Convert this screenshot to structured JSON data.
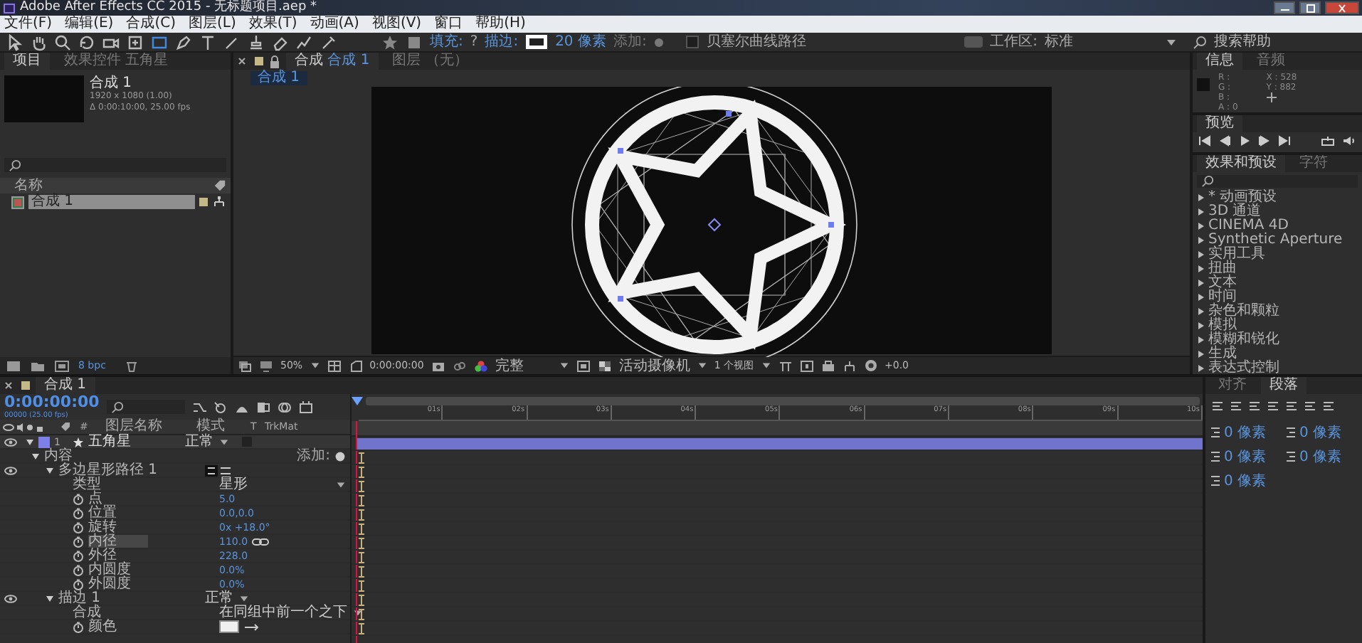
{
  "window": {
    "title": "Adobe After Effects CC 2015 - 无标题项目.aep *"
  },
  "menu": [
    "文件(F)",
    "编辑(E)",
    "合成(C)",
    "图层(L)",
    "效果(T)",
    "动画(A)",
    "视图(V)",
    "窗口",
    "帮助(H)"
  ],
  "tools": [
    {
      "kind": "select",
      "selected": false
    },
    {
      "kind": "hand",
      "selected": false
    },
    {
      "kind": "zoom",
      "selected": false
    },
    {
      "kind": "rotate",
      "selected": false
    },
    {
      "kind": "camera",
      "selected": false
    },
    {
      "kind": "pan",
      "selected": false
    },
    {
      "kind": "rect",
      "selected": true
    },
    {
      "kind": "pen",
      "selected": false
    },
    {
      "kind": "text",
      "selected": false
    },
    {
      "kind": "brush",
      "selected": false
    },
    {
      "kind": "stamp",
      "selected": false
    },
    {
      "kind": "eraser",
      "selected": false
    },
    {
      "kind": "roto",
      "selected": false
    },
    {
      "kind": "pin",
      "selected": false
    }
  ],
  "shape_options": {
    "fill_label": "填充:",
    "fill_value": "?",
    "stroke_label": "描边:",
    "stroke_width": "20 像素",
    "add_label": "添加:",
    "bezier": {
      "label": "贝塞尔曲线路径",
      "checked": false
    }
  },
  "workspace": {
    "label": "工作区:",
    "value": "标准"
  },
  "help_search": {
    "placeholder": "搜索帮助"
  },
  "project": {
    "tabs": [
      {
        "label": "项目",
        "selected": true
      },
      {
        "label": "效果控件 五角星",
        "selected": false
      }
    ],
    "comp_name": "合成 1",
    "comp_size": "1920 x 1080 (1.00)",
    "comp_duration": "Δ 0:00:10:00, 25.00 fps",
    "name_column": "名称",
    "items": [
      {
        "name": "合成 1",
        "selected": true,
        "color": "#c4b788"
      }
    ],
    "bpc": "8 bpc"
  },
  "viewer": {
    "tabs": [
      {
        "prefix": "合成",
        "label": "合成 1",
        "selected": true
      },
      {
        "prefix": "图层",
        "label": "（无）",
        "selected": false
      }
    ],
    "breadcrumb": "合成 1",
    "zoom": "50%",
    "timecode": "0:00:00:00",
    "resolution": "完整",
    "camera": "活动摄像机",
    "views": "1 个视图",
    "exposure": "+0.0"
  },
  "info": {
    "tabs": [
      {
        "label": "信息",
        "selected": true
      },
      {
        "label": "音频",
        "selected": false
      }
    ],
    "channels": [
      "R :",
      "G :",
      "B :",
      "A : 0"
    ],
    "coords": [
      "X : 528",
      "Y : 882"
    ]
  },
  "preview": {
    "title": "预览"
  },
  "effects": {
    "tabs": [
      {
        "label": "效果和预设",
        "selected": true
      },
      {
        "label": "字符",
        "selected": false
      }
    ],
    "items": [
      {
        "label": "* 动画预设",
        "expanded": false
      },
      {
        "label": "3D 通道",
        "expanded": false
      },
      {
        "label": "CINEMA 4D",
        "expanded": false
      },
      {
        "label": "Synthetic Aperture",
        "expanded": false
      },
      {
        "label": "实用工具",
        "expanded": false
      },
      {
        "label": "扭曲",
        "expanded": false
      },
      {
        "label": "文本",
        "expanded": false
      },
      {
        "label": "时间",
        "expanded": false
      },
      {
        "label": "杂色和颗粒",
        "expanded": false
      },
      {
        "label": "模拟",
        "expanded": false
      },
      {
        "label": "模糊和锐化",
        "expanded": false
      },
      {
        "label": "生成",
        "expanded": false
      },
      {
        "label": "表达式控制",
        "expanded": false
      }
    ]
  },
  "timeline": {
    "tab": "合成 1",
    "timecode": "0:00:00:00",
    "frame": "00000 (25.00 fps)",
    "columns": {
      "number": "#",
      "name": "图层名称",
      "mode": "模式",
      "t": "T",
      "trkmat": "TrkMat"
    },
    "ruler": [
      "01s",
      "02s",
      "03s",
      "04s",
      "05s",
      "06s",
      "07s",
      "08s",
      "09s",
      "10s"
    ],
    "layers": [
      {
        "kind": "layer",
        "number": "1",
        "name": "五角星",
        "mode": "正常",
        "color": "#7d80e6",
        "expanded": true,
        "visible": true,
        "selected": false,
        "children": [
          {
            "kind": "group",
            "name": "内容",
            "add": "添加:",
            "expanded": true,
            "visible": false,
            "selected": false,
            "children": [
              {
                "kind": "group",
                "name": "多边星形路径 1",
                "expanded": true,
                "visible": true,
                "selected": false,
                "children": [
                  {
                    "kind": "dropdown",
                    "name": "类型",
                    "value": "星形",
                    "visible": false,
                    "selected": false
                  },
                  {
                    "kind": "prop",
                    "name": "点",
                    "value": "5.0",
                    "linked": false,
                    "visible": false,
                    "selected": false
                  },
                  {
                    "kind": "prop",
                    "name": "位置",
                    "value": "0.0,0.0",
                    "linked": false,
                    "visible": false,
                    "selected": false
                  },
                  {
                    "kind": "prop",
                    "name": "旋转",
                    "value": "0x +18.0°",
                    "linked": false,
                    "visible": false,
                    "selected": false
                  },
                  {
                    "kind": "prop",
                    "name": "内径",
                    "value": "110.0",
                    "linked": true,
                    "visible": false,
                    "selected": true
                  },
                  {
                    "kind": "prop",
                    "name": "外径",
                    "value": "228.0",
                    "linked": false,
                    "visible": false,
                    "selected": false
                  },
                  {
                    "kind": "prop",
                    "name": "内圆度",
                    "value": "0.0%",
                    "linked": false,
                    "visible": false,
                    "selected": false
                  },
                  {
                    "kind": "prop",
                    "name": "外圆度",
                    "value": "0.0%",
                    "linked": false,
                    "visible": false,
                    "selected": false
                  }
                ]
              },
              {
                "kind": "group",
                "name": "描边 1",
                "mode": "正常",
                "expanded": true,
                "visible": true,
                "selected": false,
                "children": [
                  {
                    "kind": "dropdown",
                    "name": "合成",
                    "value": "在同组中前一个之下",
                    "visible": false,
                    "selected": false
                  },
                  {
                    "kind": "color",
                    "name": "颜色",
                    "color": "#f0f0f0",
                    "visible": false,
                    "selected": false
                  }
                ]
              }
            ]
          }
        ]
      }
    ]
  },
  "paragraph": {
    "tabs": [
      {
        "label": "对齐",
        "selected": false
      },
      {
        "label": "段落",
        "selected": true
      }
    ],
    "values": [
      "0 像素",
      "0 像素",
      "0 像素",
      "0 像素",
      "0 像素"
    ]
  }
}
